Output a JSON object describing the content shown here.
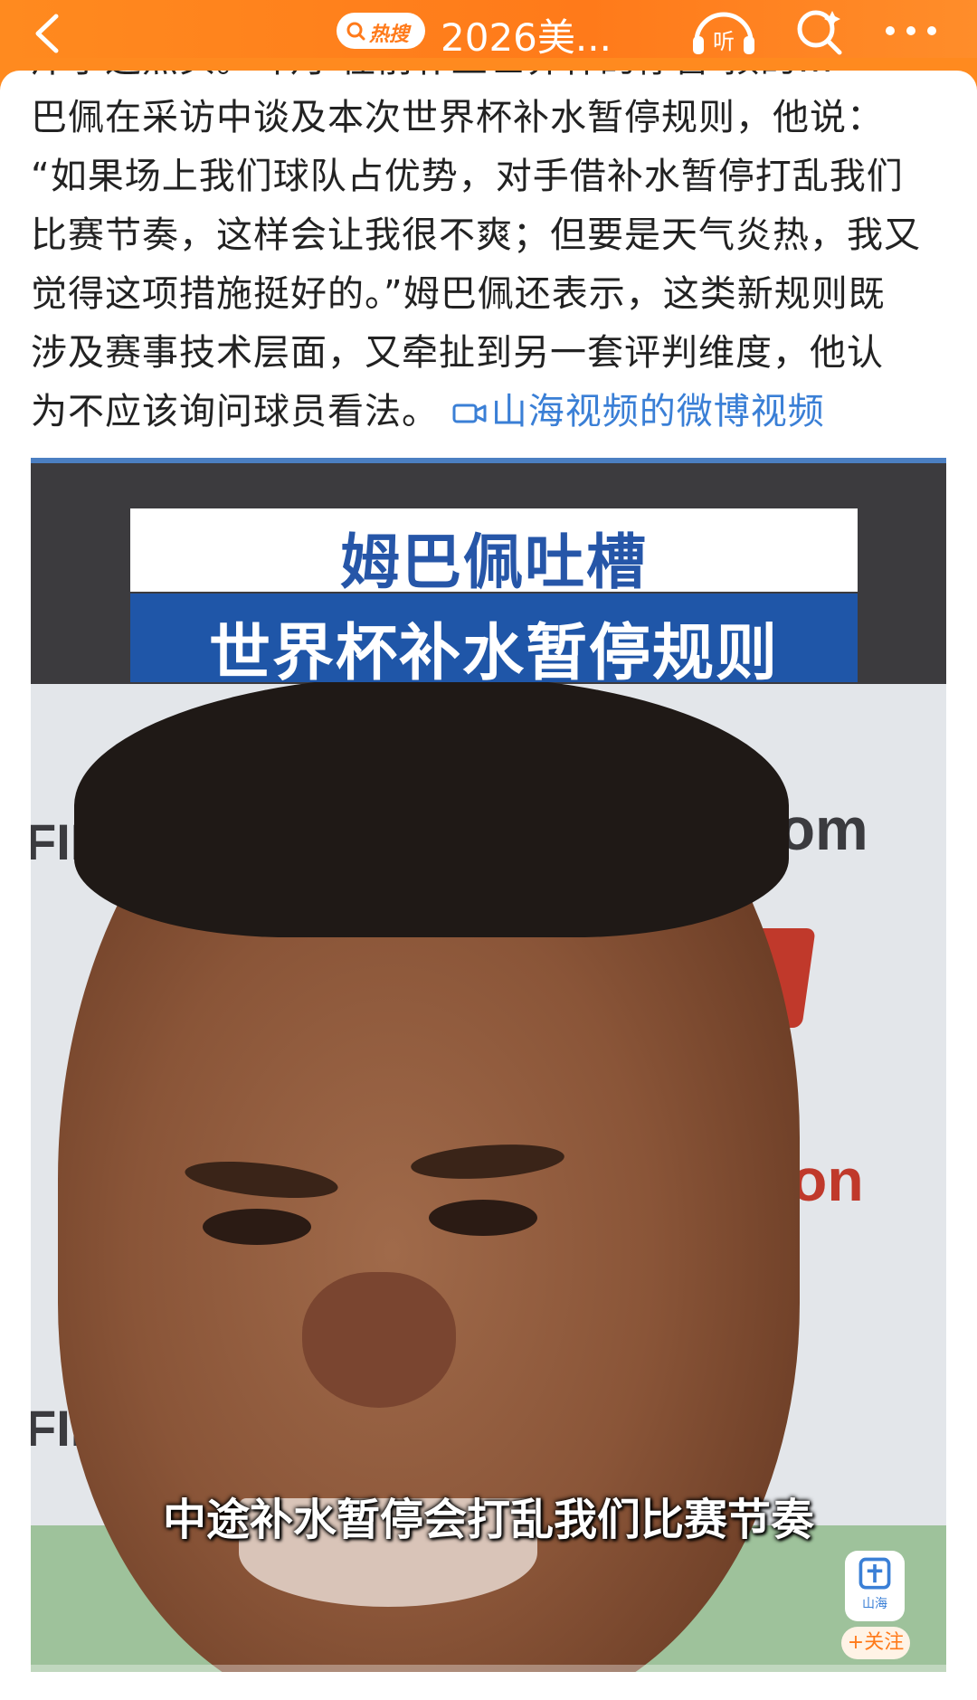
{
  "topbar": {
    "hot_search_label": "热搜",
    "title": "2026美...",
    "listen_label": "听",
    "accent_color": "#ff7a1a"
  },
  "post": {
    "cut_line": "斥了这点头。斗月 在前补上世界杯的停暂 预的…",
    "lines": [
      "巴佩在采访中谈及本次世界杯补水暂停规则，他说：",
      "“如果场上我们球队占优势，对手借补水暂停打乱我们",
      "比赛节奏，这样会让我很不爽；但要是天气炎热，我又",
      "觉得这项措施挺好的。”姆巴佩还表示，这类新规则既",
      "涉及赛事技术层面，又牵扯到另一套评判维度，他认"
    ],
    "last_line": "为不应该询问球员看法。",
    "video_link": "山海视频的微博视频",
    "link_color": "#3a7fd6"
  },
  "video": {
    "banner_title": "姆巴佩吐槽",
    "banner_subtitle": "世界杯补水暂停规则",
    "caption": "中途补水暂停会打乱我们比赛节奏",
    "bg_text_left_1": "FIF",
    "bg_text_com": "com",
    "bg_text_on": "on",
    "bg_text_left_2": "FIF",
    "channel_logo_text": "山海",
    "follow_label": "+关注"
  }
}
